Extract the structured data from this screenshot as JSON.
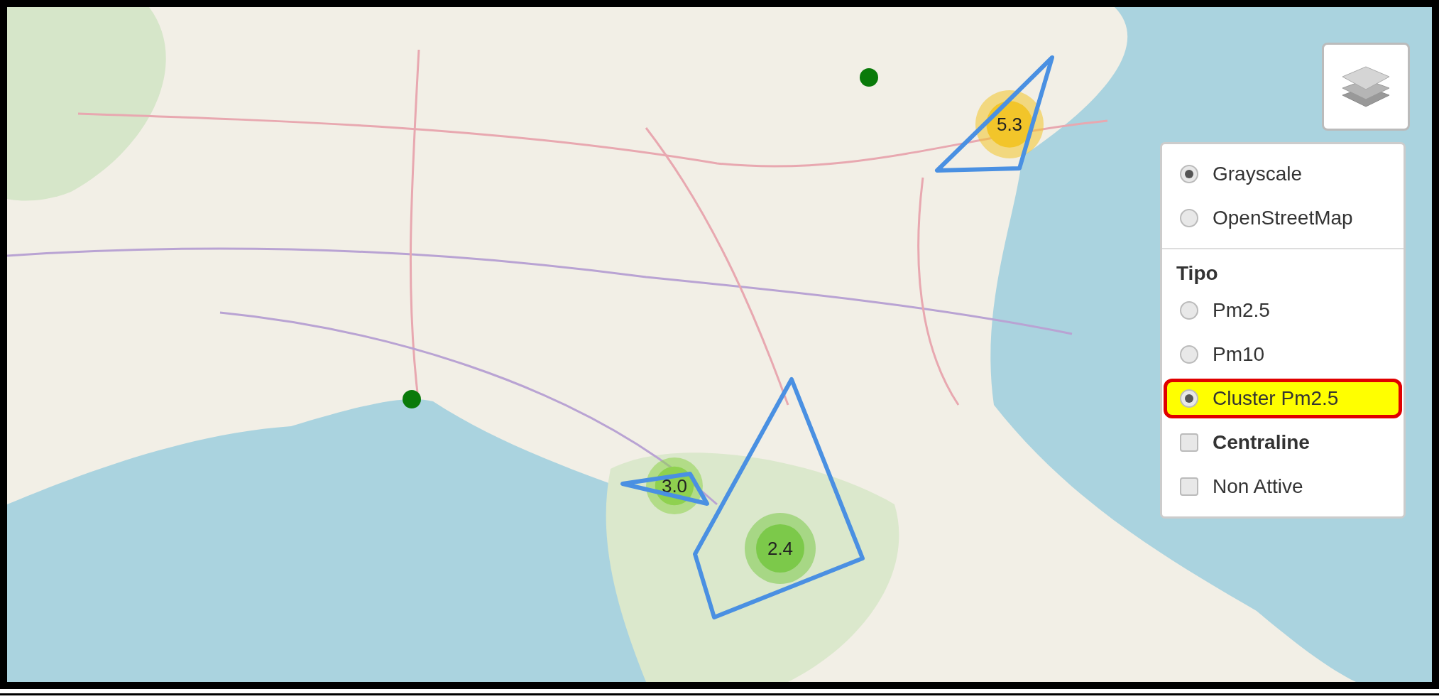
{
  "clusters": [
    {
      "label": "5.3",
      "color": "#f2c52a"
    },
    {
      "label": "3.0",
      "color": "#8fd14f"
    },
    {
      "label": "2.4",
      "color": "#7cc94a"
    }
  ],
  "layer_control": {
    "base_layers": [
      {
        "label": "Grayscale",
        "selected": true
      },
      {
        "label": "OpenStreetMap",
        "selected": false
      }
    ],
    "overlay_heading": "Tipo",
    "overlays": [
      {
        "kind": "radio",
        "label": "Pm2.5",
        "selected": false,
        "highlighted": false,
        "bold": false
      },
      {
        "kind": "radio",
        "label": "Pm10",
        "selected": false,
        "highlighted": false,
        "bold": false
      },
      {
        "kind": "radio",
        "label": "Cluster Pm2.5",
        "selected": true,
        "highlighted": true,
        "bold": false
      },
      {
        "kind": "checkbox",
        "label": "Centraline",
        "checked": false,
        "highlighted": false,
        "bold": true
      },
      {
        "kind": "checkbox",
        "label": "Non Attive",
        "checked": false,
        "highlighted": false,
        "bold": false
      }
    ]
  }
}
